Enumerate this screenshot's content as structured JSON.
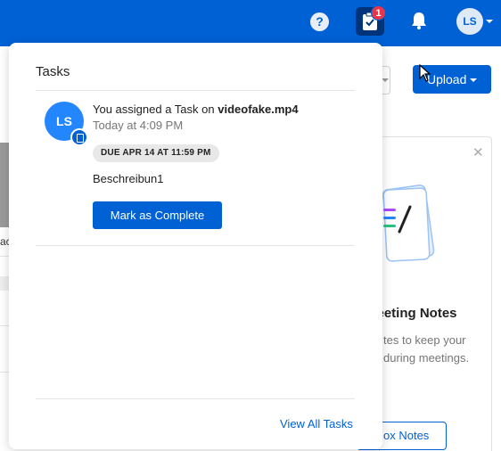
{
  "colors": {
    "brand": "#0061d5",
    "badge": "#e9344a",
    "avatar": "#2486fc"
  },
  "topbar": {
    "help_icon": "?",
    "tasks_badge_count": "1",
    "avatar_initials": "LS"
  },
  "background": {
    "upload_label": "Upload",
    "left_fragment": "ac",
    "notes_title": "Meeting Notes",
    "notes_desc_line1": "tes to keep your",
    "notes_desc_line2": "during meetings.",
    "notes_button": "ox Notes"
  },
  "tasks_popover": {
    "title": "Tasks",
    "task": {
      "avatar_initials": "LS",
      "message_prefix": "You assigned a Task on ",
      "file_name": "videofake.mp4",
      "timestamp": "Today at 4:09 PM",
      "due": "DUE APR 14 AT 11:59 PM",
      "description": "Beschreibun1",
      "complete_button": "Mark as Complete"
    },
    "view_all_label": "View All Tasks"
  }
}
